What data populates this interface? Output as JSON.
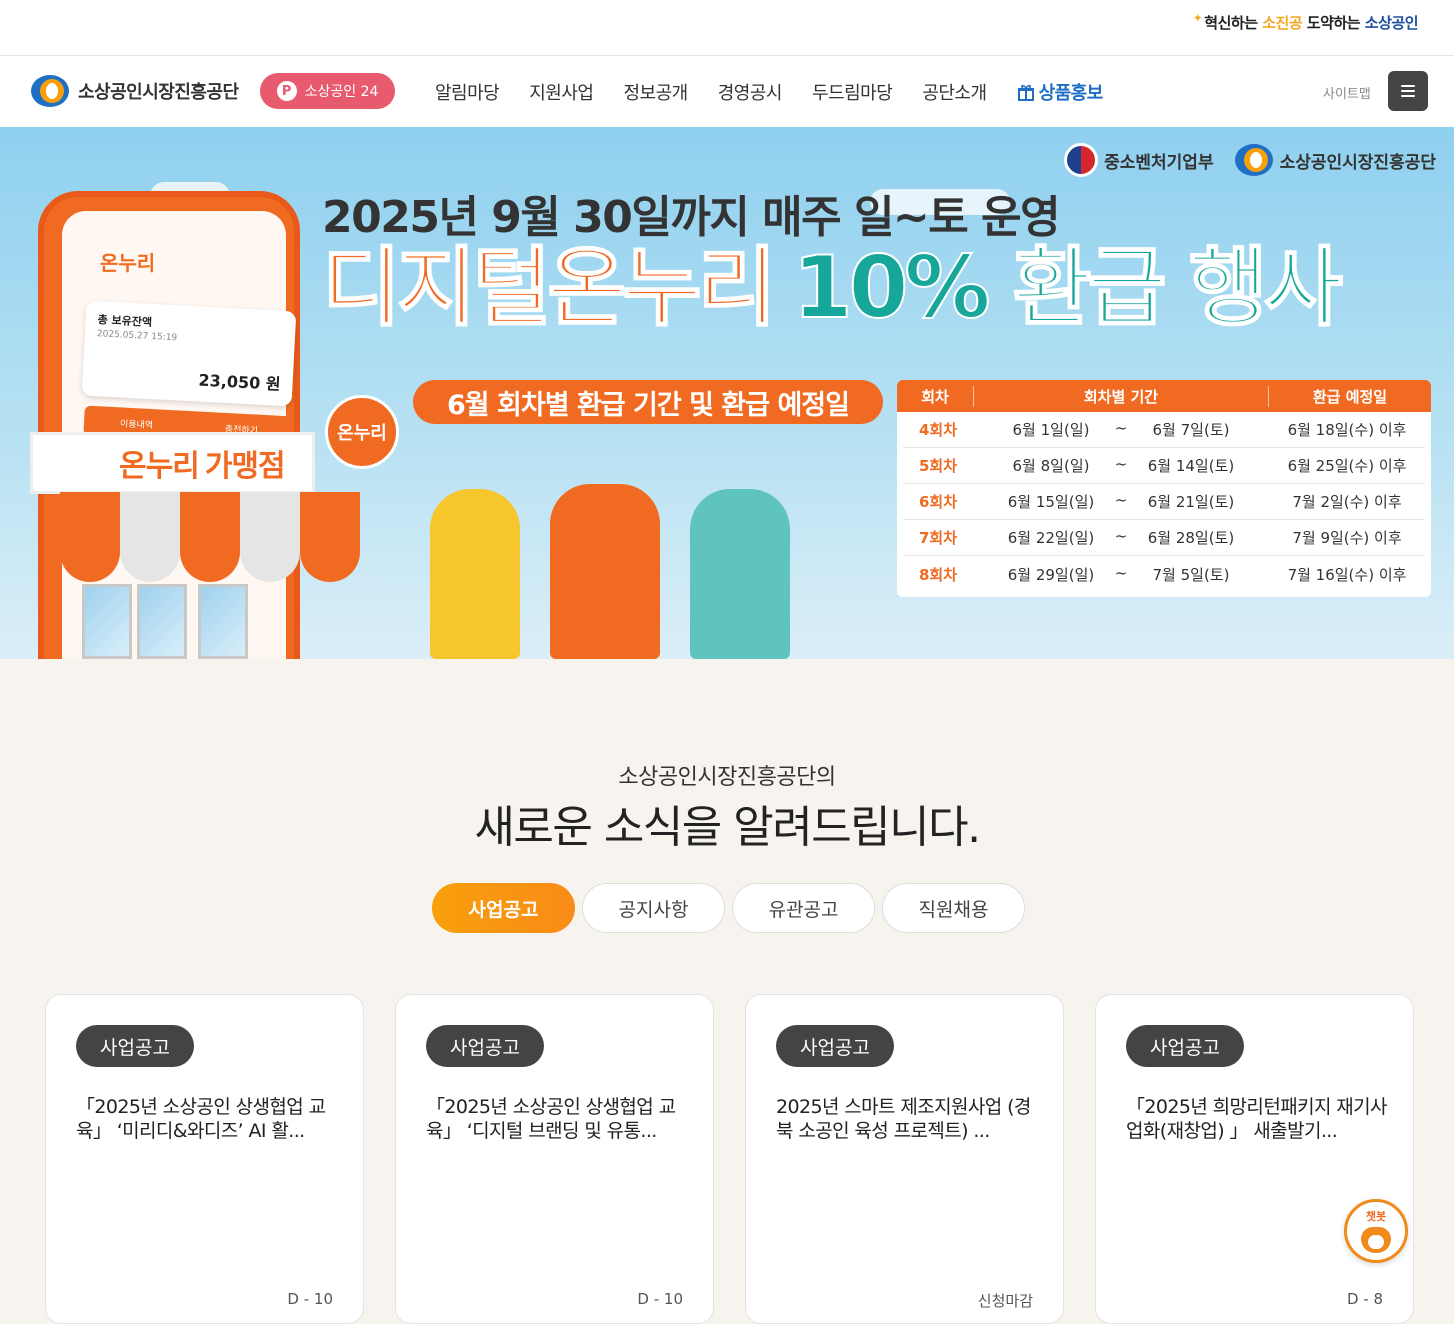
{
  "header": {
    "slogan": {
      "part1": "혁신하는 ",
      "part2": "소진공",
      "part3": " 도약하는 ",
      "part4": "소상공인"
    },
    "logo_text": "소상공인시장진흥공단",
    "pill_label": "소상공인 24",
    "menu": [
      "알림마당",
      "지원사업",
      "정보공개",
      "경영공시",
      "두드림마당",
      "공단소개"
    ],
    "promo_label": "상품홍보",
    "sitemap_label": "사이트맵",
    "icons": [
      "logo-mark-icon",
      "p-icon",
      "gift-icon",
      "hamburger-icon"
    ],
    "colors": {
      "pill": "#e85a6e",
      "promo": "#1f6fc5",
      "orange": "#f06a21",
      "teal": "#16a79a"
    }
  },
  "banner": {
    "sponsors": [
      "중소벤처기업부",
      "소상공인시장진흥공단"
    ],
    "subheading": "2025년 9월 30일까지 매주 일~토 운영",
    "headline_1": "디지털온누리",
    "headline_2": "10% 환급 행사",
    "period_pill": "6월 회차별 환급 기간 및 환급 예정일",
    "phone": {
      "logo": "온누리",
      "balance_label": "총 보유잔액",
      "date": "2025.05.27 15:19",
      "balance": "23,050 원",
      "tab1": "이용내역",
      "tab2": "충전하기"
    },
    "shop_sign_prefix": "온누리",
    "shop_sign": "가맹점",
    "badge": "온누리",
    "schedule": {
      "headers": [
        "회차",
        "회차별 기간",
        "환급 예정일"
      ],
      "rows": [
        {
          "round": "4회차",
          "from": "6월 1일(일)",
          "sep": "~",
          "to": "6월 7일(토)",
          "refund": "6월 18일(수) 이후"
        },
        {
          "round": "5회차",
          "from": "6월 8일(일)",
          "sep": "~",
          "to": "6월 14일(토)",
          "refund": "6월 25일(수) 이후"
        },
        {
          "round": "6회차",
          "from": "6월 15일(일)",
          "sep": "~",
          "to": "6월 21일(토)",
          "refund": "7월 2일(수)  이후"
        },
        {
          "round": "7회차",
          "from": "6월 22일(일)",
          "sep": "~",
          "to": "6월 28일(토)",
          "refund": "7월 9일(수)  이후"
        },
        {
          "round": "8회차",
          "from": "6월 29일(일)",
          "sep": "~",
          "to": "7월 5일(토)",
          "refund": "7월 16일(수) 이후"
        }
      ]
    }
  },
  "news": {
    "subtitle": "소상공인시장진흥공단의",
    "title": "새로운 소식을 알려드립니다.",
    "tabs": [
      "사업공고",
      "공지사항",
      "유관공고",
      "직원채용"
    ],
    "cards": [
      {
        "badge": "사업공고",
        "title": "「2025년 소상공인 상생협업 교육」 ‘미리디&와디즈’ AI 활...",
        "meta": "D - 10"
      },
      {
        "badge": "사업공고",
        "title": "「2025년 소상공인 상생협업 교육」 ‘디지털 브랜딩 및 유통...",
        "meta": "D - 10"
      },
      {
        "badge": "사업공고",
        "title": "2025년 스마트 제조지원사업 (경북 소공인 육성 프로젝트) ...",
        "meta": "신청마감"
      },
      {
        "badge": "사업공고",
        "title": "「2025년 희망리턴패키지 재기사업화(재창업) 」 새출발기...",
        "meta": "D - 8"
      }
    ]
  },
  "chatbot_label": "챗봇"
}
